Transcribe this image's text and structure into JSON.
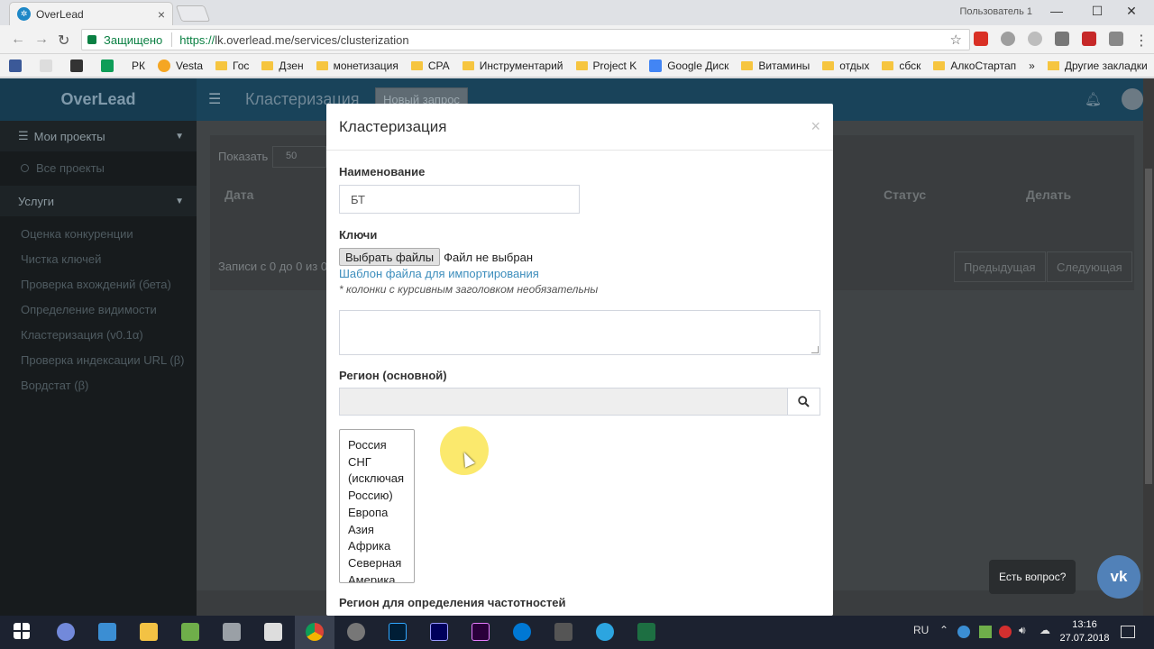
{
  "browser": {
    "tab_title": "OverLead",
    "tab_close": "×",
    "window_user": "Пользователь 1",
    "controls": {
      "minimize": "—",
      "maximize": "☐",
      "close": "✕"
    },
    "secure_label": "Защищено",
    "url_protocol": "https://",
    "url_rest": "lk.overlead.me/services/clusterization",
    "bookmarks": [
      "РК",
      "Vesta",
      "Гос",
      "Дзен",
      "монетизация",
      "CPA",
      "Инструментарий",
      "Project K",
      "Google Диск",
      "Витамины",
      "отдых",
      "сбск",
      "АлкоСтартап"
    ],
    "bookmark_more": "»",
    "other_bookmarks": "Другие закладки"
  },
  "app": {
    "logo": "OverLead",
    "page_title": "Кластеризация",
    "new_request_btn": "Новый запрос"
  },
  "sidebar": {
    "my_projects": "Мои проекты",
    "all_projects": "Все проекты",
    "services": "Услуги",
    "items": [
      "Оценка конкуренции",
      "Чистка ключей",
      "Проверка вхождений (бета)",
      "Определение видимости",
      "Кластеризация (v0.1α)",
      "Проверка индексации URL (β)",
      "Вордстат (β)"
    ]
  },
  "table": {
    "show_label": "Показать",
    "show_value": "50",
    "col_date": "Дата",
    "col_status": "Статус",
    "col_action": "Делать",
    "records_info": "Записи с 0 до 0 из 0",
    "prev_btn": "Предыдущая",
    "next_btn": "Следующая"
  },
  "modal": {
    "title": "Кластеризация",
    "close": "×",
    "name_label": "Наименование",
    "name_value": "БТ",
    "keys_label": "Ключи",
    "choose_files_btn": "Выбрать файлы",
    "no_file": "Файл не выбран",
    "template_link": "Шаблон файла для импортирования",
    "note": "* колонки с курсивным заголовком необязательны",
    "region_label": "Регион (основной)",
    "regions": [
      "Россия",
      "СНГ",
      "(исключая",
      "Россию)",
      "Европа",
      "Азия",
      "Африка",
      "Северная",
      "Америка"
    ],
    "freq_region_label": "Регион для определения частотностей"
  },
  "widget": {
    "question": "Есть вопрос?",
    "vk": "vk"
  },
  "taskbar": {
    "lang": "RU",
    "time": "13:16",
    "date": "27.07.2018"
  },
  "colors": {
    "header": "#19435a",
    "sidebar": "#171b1d",
    "link": "#3c8dbc",
    "vk": "#5181b8"
  }
}
